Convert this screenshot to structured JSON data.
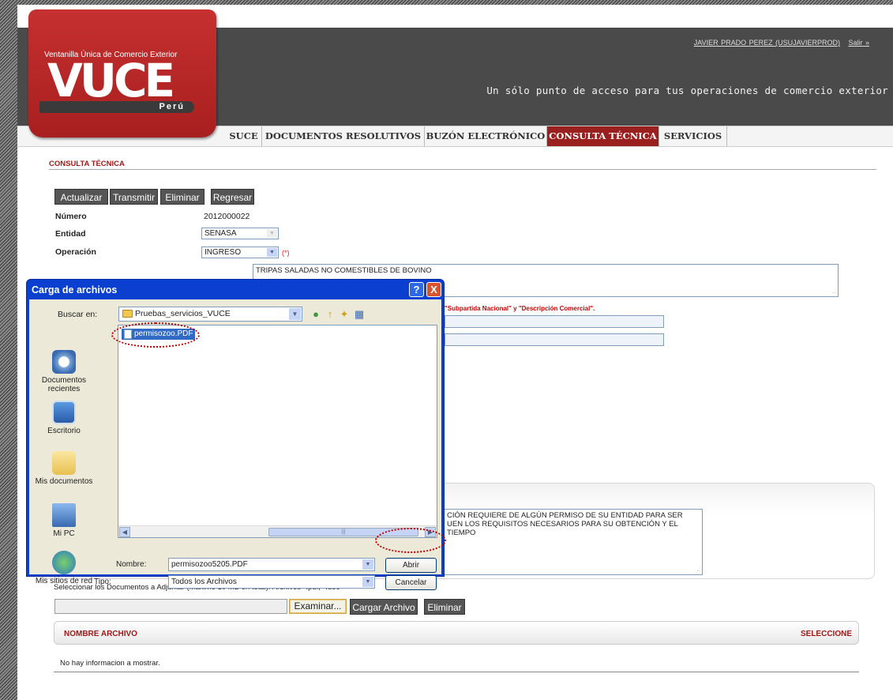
{
  "header": {
    "user": "JAVIER PRADO PEREZ (USUJAVIERPROD)",
    "logout": "Salir »",
    "slogan": "Un sólo punto de acceso para tus operaciones de comercio exterior",
    "logo": {
      "top": "Ventanilla Única de Comercio Exterior",
      "main": "VUCE",
      "country": "Perú",
      "color": "#b52424"
    }
  },
  "nav": {
    "items": [
      "SUCE",
      "DOCUMENTOS RESOLUTIVOS",
      "BUZÓN ELECTRÓNICO",
      "CONSULTA TÉCNICA",
      "SERVICIOS"
    ],
    "active": "CONSULTA TÉCNICA",
    "active_color": "#9a1f1f"
  },
  "section": {
    "title": "CONSULTA TÉCNICA"
  },
  "toolbar": {
    "actualizar": "Actualizar",
    "transmitir": "Transmitir",
    "eliminar": "Eliminar",
    "regresar": "Regresar"
  },
  "form": {
    "numero_label": "Número",
    "numero": "2012000022",
    "entidad_label": "Entidad",
    "entidad": "SENASA",
    "operacion_label": "Operación",
    "operacion": "INGRESO",
    "required": "(*)",
    "producto": "TRIPAS SALADAS NO COMESTIBLES DE BOVINO",
    "note": "\"Subpartida Nacional\" y \"Descripción Comercial\".",
    "consulta_line1": "CIÓN REQUIERE DE ALGÚN PERMISO DE SU ENTIDAD PARA SER",
    "consulta_line2": "UEN LOS REQUISITOS NECESARIOS PARA SU OBTENCIÓN Y EL TIEMPO"
  },
  "attachments": {
    "instructions": "Seleccionar los Documentos a Adjuntar (Máximo 10 MB en total): Archivos *.pdf, *.doc",
    "examinar": "Examinar...",
    "cargar": "Cargar Archivo",
    "eliminar": "Eliminar",
    "columns": [
      "NOMBRE ARCHIVO",
      "SELECCIONE"
    ],
    "empty": "No hay informacion a mostrar."
  },
  "dialog": {
    "title": "Carga de archivos",
    "help": "?",
    "close": "X",
    "buscar_label": "Buscar en:",
    "folder": "Pruebas_servicios_VUCE",
    "places": [
      "Documentos recientes",
      "Escritorio",
      "Mis documentos",
      "Mi PC",
      "Mis sitios de red"
    ],
    "files": [
      "permisozoo.PDF"
    ],
    "nombre_label": "Nombre:",
    "nombre": "permisozoo5205.PDF",
    "tipo_label": "Tipo:",
    "tipo": "Todos los Archivos",
    "abrir": "Abrir",
    "cancelar": "Cancelar",
    "title_color": "#0a3fd0"
  }
}
